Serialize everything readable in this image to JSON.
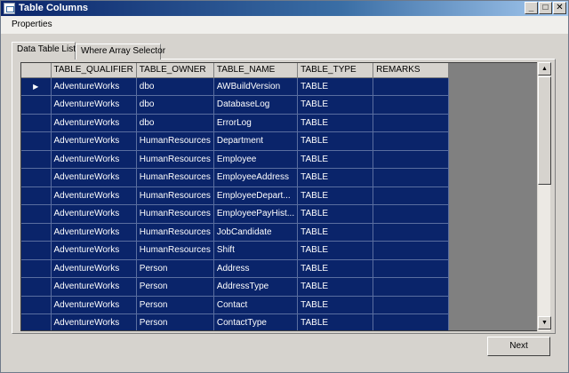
{
  "window": {
    "title": "Table Columns",
    "minimize_glyph": "_",
    "restore_glyph": "□",
    "close_glyph": "✕"
  },
  "menu": {
    "items": [
      "Properties"
    ]
  },
  "tabs": [
    "Data Table List",
    "Where Array Selector"
  ],
  "grid": {
    "columns": [
      "TABLE_QUALIFIER",
      "TABLE_OWNER",
      "TABLE_NAME",
      "TABLE_TYPE",
      "REMARKS"
    ],
    "current_row_glyph": "▶",
    "rows": [
      [
        "AdventureWorks",
        "dbo",
        "AWBuildVersion",
        "TABLE",
        ""
      ],
      [
        "AdventureWorks",
        "dbo",
        "DatabaseLog",
        "TABLE",
        ""
      ],
      [
        "AdventureWorks",
        "dbo",
        "ErrorLog",
        "TABLE",
        ""
      ],
      [
        "AdventureWorks",
        "HumanResources",
        "Department",
        "TABLE",
        ""
      ],
      [
        "AdventureWorks",
        "HumanResources",
        "Employee",
        "TABLE",
        ""
      ],
      [
        "AdventureWorks",
        "HumanResources",
        "EmployeeAddress",
        "TABLE",
        ""
      ],
      [
        "AdventureWorks",
        "HumanResources",
        "EmployeeDepart...",
        "TABLE",
        ""
      ],
      [
        "AdventureWorks",
        "HumanResources",
        "EmployeePayHist...",
        "TABLE",
        ""
      ],
      [
        "AdventureWorks",
        "HumanResources",
        "JobCandidate",
        "TABLE",
        ""
      ],
      [
        "AdventureWorks",
        "HumanResources",
        "Shift",
        "TABLE",
        ""
      ],
      [
        "AdventureWorks",
        "Person",
        "Address",
        "TABLE",
        ""
      ],
      [
        "AdventureWorks",
        "Person",
        "AddressType",
        "TABLE",
        ""
      ],
      [
        "AdventureWorks",
        "Person",
        "Contact",
        "TABLE",
        ""
      ],
      [
        "AdventureWorks",
        "Person",
        "ContactType",
        "TABLE",
        ""
      ]
    ]
  },
  "scrollbar": {
    "up_glyph": "▲",
    "down_glyph": "▼"
  },
  "footer": {
    "next_label": "Next"
  },
  "colors": {
    "selection": "#0a246a",
    "grid_background": "#808080",
    "window": "#d6d3ce"
  }
}
